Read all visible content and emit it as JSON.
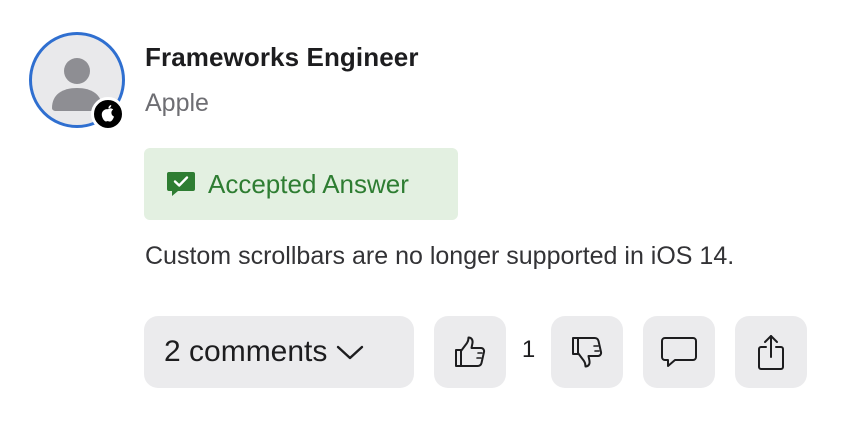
{
  "author": {
    "name": "Frameworks Engineer",
    "organization": "Apple",
    "avatar_icon": "person-icon",
    "badge_icon": "apple-logo-icon",
    "avatar_ring_color": "#2f6fd0"
  },
  "accepted": {
    "label": "Accepted Answer",
    "icon": "checkmark-bubble-icon",
    "color": "#2e7d32",
    "background": "#e3f0e1"
  },
  "answer": {
    "body": "Custom scrollbars are no longer supported in iOS 14."
  },
  "actions": {
    "comments_label": "2 comments",
    "comments_icon": "chevron-down-icon",
    "like_icon": "thumbs-up-icon",
    "vote_count": "1",
    "dislike_icon": "thumbs-down-icon",
    "reply_icon": "comment-bubble-icon",
    "share_icon": "share-icon"
  }
}
